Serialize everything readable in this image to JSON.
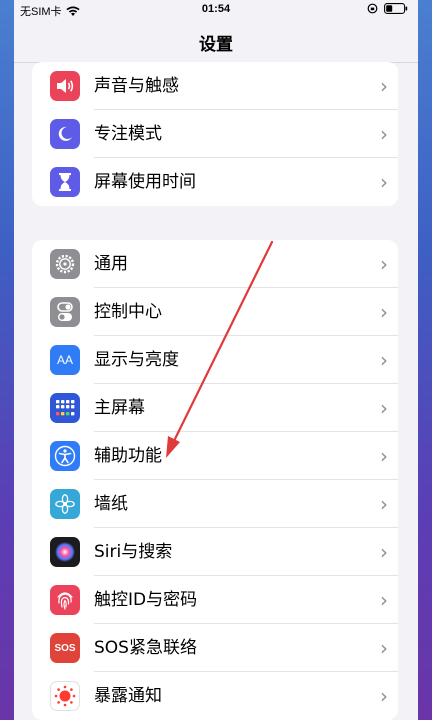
{
  "status_bar": {
    "carrier": "无SIM卡",
    "time": "01:54"
  },
  "nav": {
    "title": "设置"
  },
  "group1": [
    {
      "label": "声音与触感",
      "icon": "speaker-icon",
      "color": "#eb445a"
    },
    {
      "label": "专注模式",
      "icon": "moon-icon",
      "color": "#5e5ce6"
    },
    {
      "label": "屏幕使用时间",
      "icon": "hourglass-icon",
      "color": "#5e5ce6"
    }
  ],
  "group2": [
    {
      "label": "通用",
      "icon": "gear-icon",
      "color": "#8e8e93"
    },
    {
      "label": "控制中心",
      "icon": "toggles-icon",
      "color": "#8e8e93"
    },
    {
      "label": "显示与亮度",
      "icon": "text-size-icon",
      "color": "#2f7cf6"
    },
    {
      "label": "主屏幕",
      "icon": "app-grid-icon",
      "color": "#2f57d8"
    },
    {
      "label": "辅助功能",
      "icon": "accessibility-icon",
      "color": "#2f7cf6"
    },
    {
      "label": "墙纸",
      "icon": "flower-icon",
      "color": "#36a8d8"
    },
    {
      "label": "Siri与搜索",
      "icon": "siri-icon",
      "color": "#1c1c1e"
    },
    {
      "label": "触控ID与密码",
      "icon": "fingerprint-icon",
      "color": "#eb445a"
    },
    {
      "label": "SOS紧急联络",
      "icon": "sos-icon",
      "color": "#e0433a"
    },
    {
      "label": "暴露通知",
      "icon": "exposure-icon",
      "color": "#ffffff"
    }
  ],
  "icon_text": {
    "text_size": "AA",
    "sos": "SOS"
  },
  "chevron": "›",
  "annotation_color": "#e03a3a"
}
